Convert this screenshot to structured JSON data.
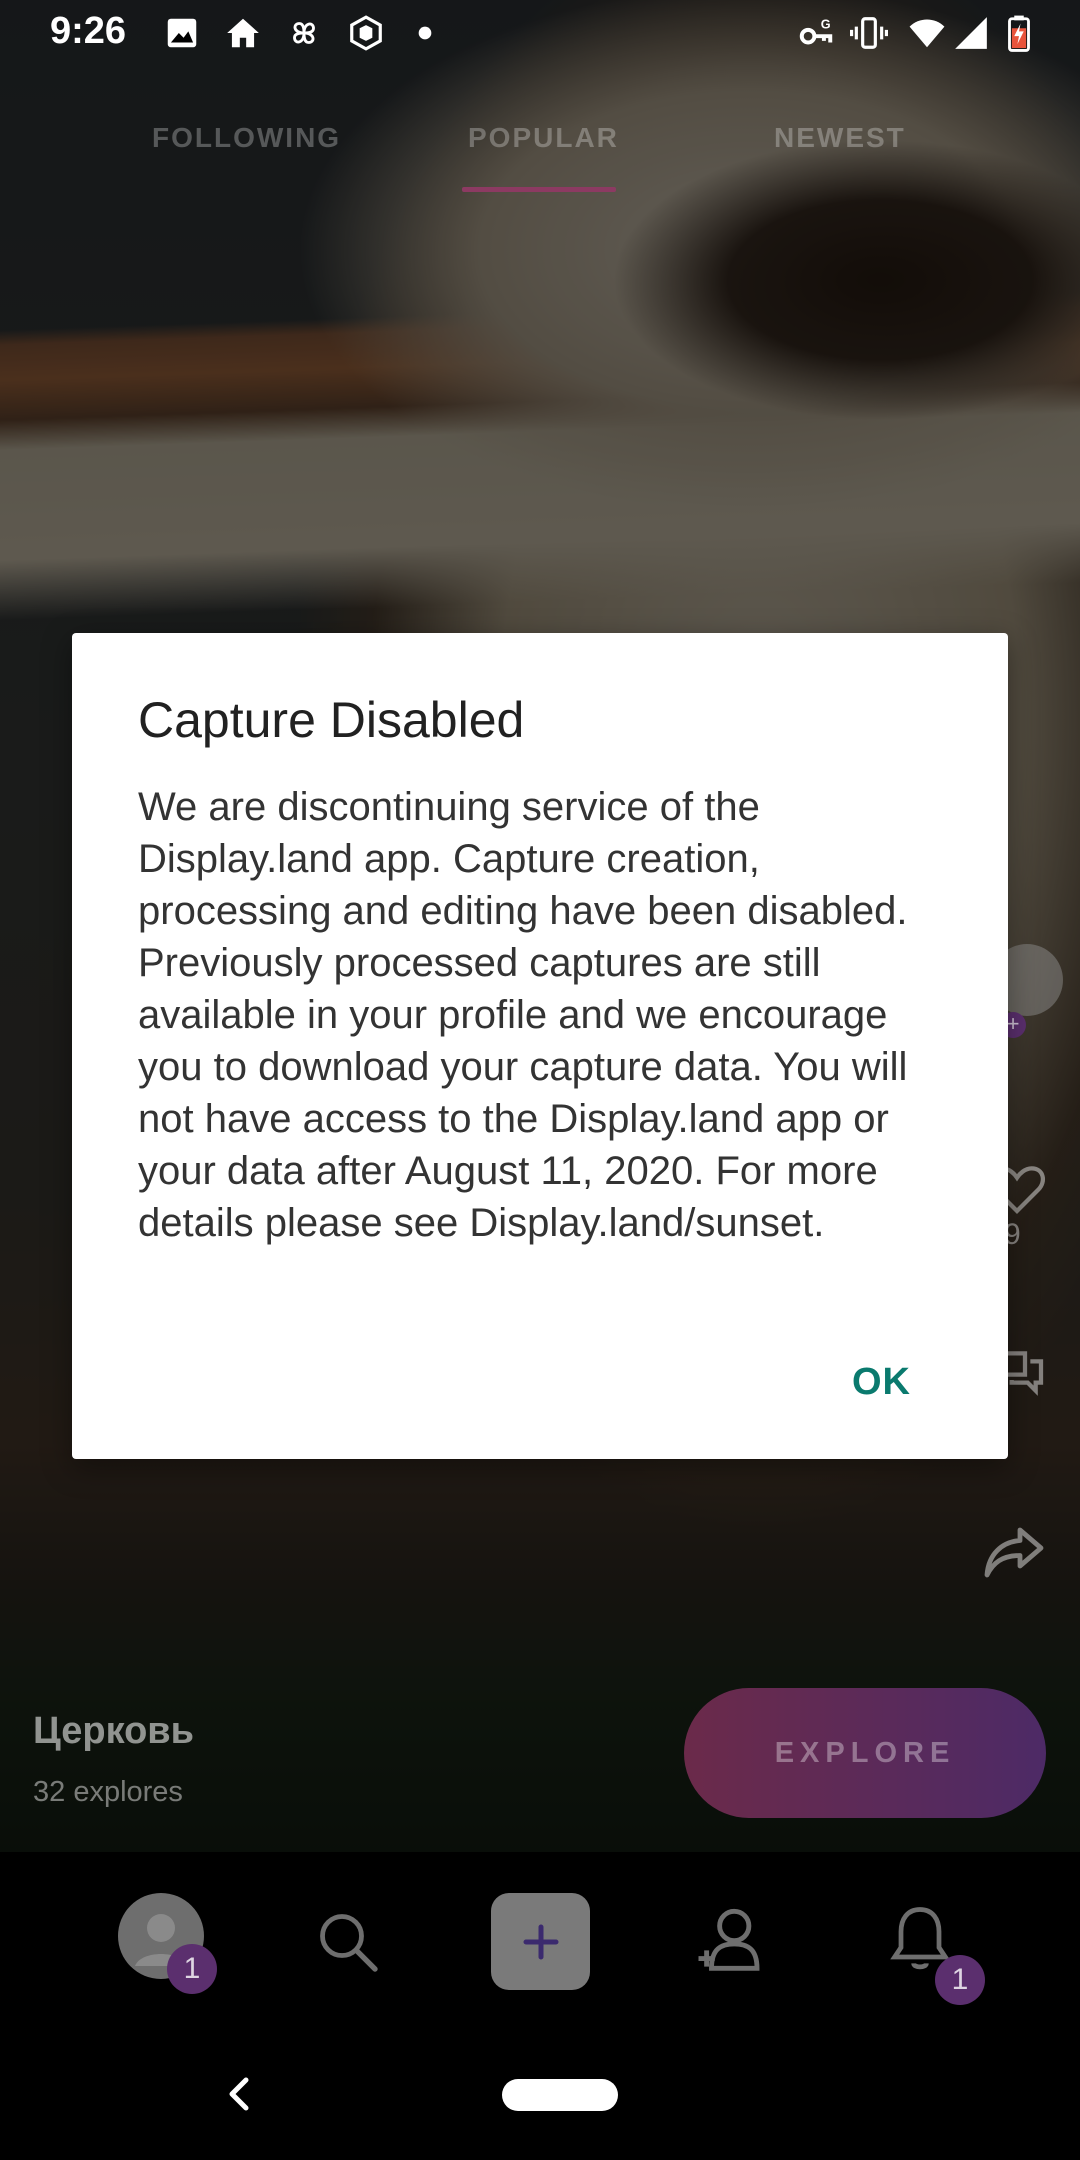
{
  "status_bar": {
    "time": "9:26",
    "left_icons": [
      "image-icon",
      "home-icon",
      "pinwheel-icon",
      "shield-app-icon",
      "dot-icon"
    ],
    "right_icons": [
      "vpn-key-icon",
      "vibrate-icon",
      "wifi-icon",
      "signal-icon",
      "battery-icon"
    ]
  },
  "tabs": [
    {
      "label": "FOLLOWING"
    },
    {
      "label": "POPULAR"
    },
    {
      "label": "NEWEST"
    }
  ],
  "side_actions": {
    "like_count": "9",
    "icons": [
      "follow-avatar-icon",
      "heart-icon",
      "comment-icon",
      "share-icon"
    ]
  },
  "capture": {
    "title": "Церковь",
    "subtitle": "32 explores",
    "explore_label": "EXPLORE"
  },
  "bottom_nav": {
    "profile_badge": "1",
    "notifications_badge": "1",
    "icons": [
      "avatar-icon",
      "search-icon",
      "plus-icon",
      "add-person-icon",
      "bell-icon"
    ]
  },
  "dialog": {
    "title": "Capture Disabled",
    "body": "We are discontinuing service of the Display.land app. Capture creation, processing and editing have been disabled. Previously processed captures are still available in your profile and we encourage you to download your capture data. You will not have access to the Display.land app or your data after August 11, 2020. For more details please see Display.land/sunset.",
    "ok_label": "OK"
  },
  "colors": {
    "accent_teal": "#0a7a6e",
    "tab_indicator": "#8c3a62",
    "badge": "#5b2f6e"
  }
}
